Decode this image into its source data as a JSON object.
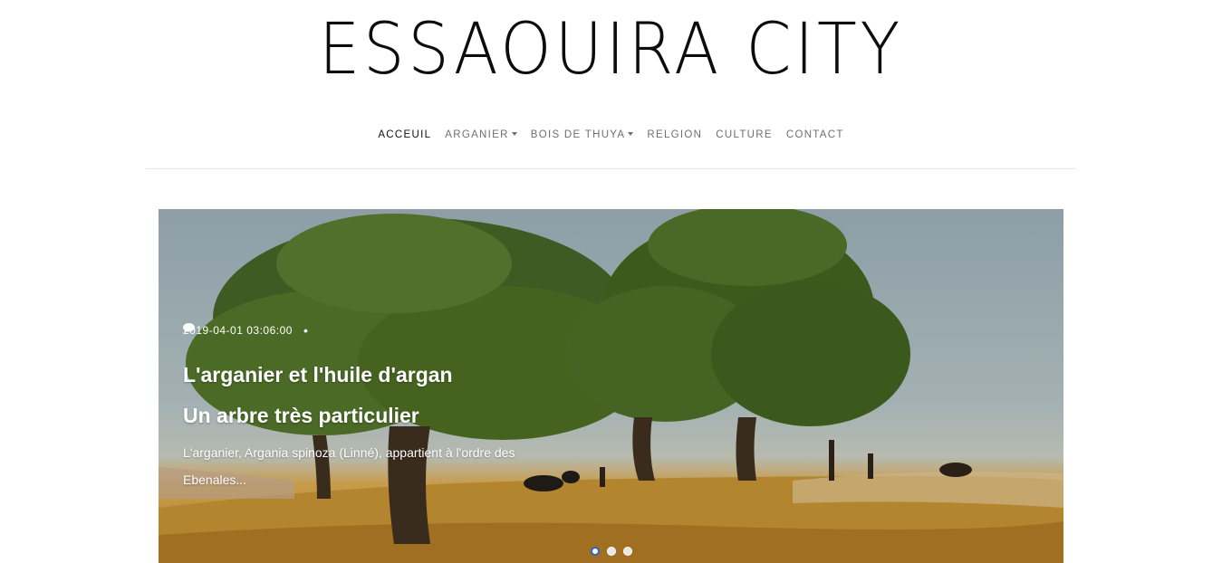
{
  "site": {
    "title": "ESSAOUIRA CITY"
  },
  "nav": {
    "items": [
      {
        "label": "ACCEUIL",
        "active": true,
        "dropdown": false
      },
      {
        "label": "ARGANIER",
        "active": false,
        "dropdown": true
      },
      {
        "label": "BOIS DE THUYA",
        "active": false,
        "dropdown": true
      },
      {
        "label": "RELGION",
        "active": false,
        "dropdown": false
      },
      {
        "label": "CULTURE",
        "active": false,
        "dropdown": false
      },
      {
        "label": "CONTACT",
        "active": false,
        "dropdown": false
      }
    ]
  },
  "hero": {
    "date": "2019-04-01 03:06:00",
    "separator": "•",
    "comment_icon": "comment-icon",
    "title_line1": "L'arganier et l'huile d'argan",
    "title_line2": "Un arbre très particulier",
    "excerpt": "L'arganier, Argania spinoza (Linné), appartient à l'ordre des Ebenales...",
    "slides": {
      "count": 3,
      "active_index": 0
    }
  },
  "colors": {
    "indicator_active": "#2b64c8",
    "text": "#111111",
    "nav": "#6f6f6f"
  }
}
